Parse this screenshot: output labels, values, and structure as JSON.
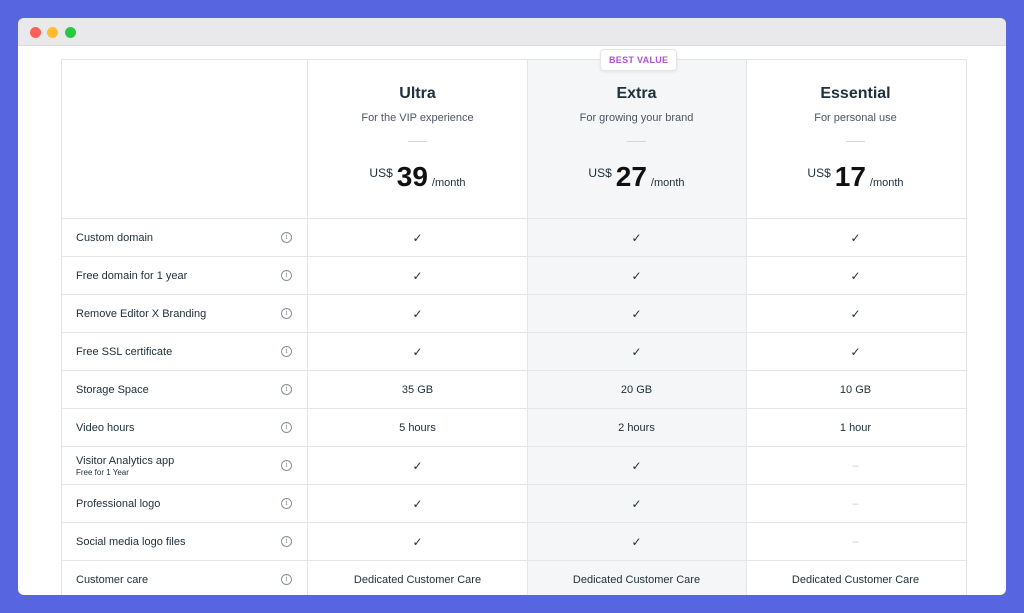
{
  "window": {
    "colors": {
      "close": "#fe5f57",
      "minimize": "#febc2e",
      "maximize": "#28c840"
    }
  },
  "badge": "BEST VALUE",
  "plans": [
    {
      "name": "Ultra",
      "desc": "For the VIP experience",
      "currency": "US$",
      "price": "39",
      "period": "/month"
    },
    {
      "name": "Extra",
      "desc": "For growing your brand",
      "currency": "US$",
      "price": "27",
      "period": "/month"
    },
    {
      "name": "Essential",
      "desc": "For personal use",
      "currency": "US$",
      "price": "17",
      "period": "/month"
    }
  ],
  "features": [
    {
      "label": "Custom domain",
      "sub": "",
      "values": [
        "check",
        "check",
        "check"
      ]
    },
    {
      "label": "Free domain for 1 year",
      "sub": "",
      "values": [
        "check",
        "check",
        "check"
      ]
    },
    {
      "label": "Remove Editor X Branding",
      "sub": "",
      "values": [
        "check",
        "check",
        "check"
      ]
    },
    {
      "label": "Free SSL certificate",
      "sub": "",
      "values": [
        "check",
        "check",
        "check"
      ]
    },
    {
      "label": "Storage Space",
      "sub": "",
      "values": [
        "35 GB",
        "20 GB",
        "10 GB"
      ]
    },
    {
      "label": "Video hours",
      "sub": "",
      "values": [
        "5 hours",
        "2 hours",
        "1 hour"
      ]
    },
    {
      "label": "Visitor Analytics app",
      "sub": "Free for 1 Year",
      "values": [
        "check",
        "check",
        "dash"
      ]
    },
    {
      "label": "Professional logo",
      "sub": "",
      "values": [
        "check",
        "check",
        "dash"
      ]
    },
    {
      "label": "Social media logo files",
      "sub": "",
      "values": [
        "check",
        "check",
        "dash"
      ]
    },
    {
      "label": "Customer care",
      "sub": "",
      "values": [
        "Dedicated Customer Care",
        "Dedicated Customer Care",
        "Dedicated Customer Care"
      ]
    }
  ],
  "icons": {
    "check": "✓",
    "dash": "–",
    "info": "i"
  },
  "colors": {
    "background": "#5865e0",
    "badge_text": "#b151d6",
    "highlight_column": "#f5f6f8"
  }
}
